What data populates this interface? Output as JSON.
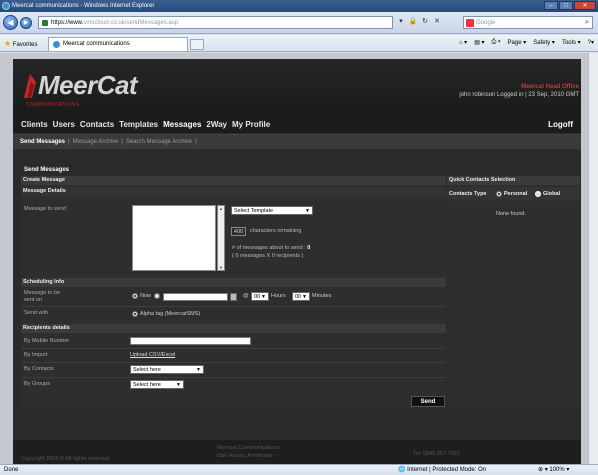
{
  "browser": {
    "title": "Meercat communications - Windows Internet Explorer",
    "address_prefix": "https://www.",
    "address_rest": "smscloud.co.uk/sendMessages.asp",
    "search_placeholder": "Google",
    "favorites_label": "Favorites",
    "tab_title": "Meercat communications",
    "commands": [
      "Page ▾",
      "Safety ▾",
      "Tools ▾"
    ],
    "status_left": "Done",
    "status_zone": "Internet | Protected Mode: On",
    "zoom": "100%"
  },
  "header": {
    "logo_text": "MeerCat",
    "logo_sub": "COMMUNICATIONS",
    "office": "Meercat Head Office",
    "user_line": "john robinson Logged in | 23 Sep, 2010 GMT"
  },
  "mainnav": {
    "items": [
      "Clients",
      "Users",
      "Contacts",
      "Templates",
      "Messages",
      "2Way",
      "My Profile"
    ],
    "logoff": "Logoff"
  },
  "subnav": {
    "items": [
      "Send Messages",
      "Message Archive",
      "Search Message Archive"
    ]
  },
  "form": {
    "page_heading": "Send Messages",
    "create_message": "Create Message",
    "message_details": "Message Details",
    "message_to_send": "Message to send",
    "template_select": "Select Template",
    "chars_remaining_value": "400",
    "chars_remaining_label": "characters remaining",
    "msg_count_label": "# of messages about to send : ",
    "msg_count_value": "0",
    "msg_count_detail": "( 0 messages X 0 recipients )",
    "scheduling_info": "Scheduling Info",
    "message_sent_on": "Message to be sent on",
    "now_label": "Now",
    "at_label": "@",
    "hours_value": "00",
    "hours_label": "Hours",
    "minutes_value": "00",
    "minutes_label": "Minutes",
    "send_with": "Send with",
    "alpha_tag": "Alpha tag (MeercatSMS)",
    "recipients_details": "Recipients details",
    "by_mobile": "By Mobile Number",
    "by_import": "By Import",
    "upload_link": "Upload CSV/Excel",
    "by_contacts": "By Contacts",
    "by_groups": "By Groups",
    "select_here": "Select here",
    "send_button": "Send"
  },
  "quick_contacts": {
    "heading": "Quick Contacts Selection",
    "contacts_type": "Contacts Type",
    "personal": "Personal",
    "global": "Global",
    "none_found": "None found."
  },
  "footer": {
    "copyright": "Copyright 2004 © All rights reserved",
    "company": "Meercat Communications",
    "address": "Oak House, Armthorpe",
    "tel": "Tel: 0845 257 7397"
  },
  "colors": {
    "accent_red": "#c23a3a",
    "site_bg": "#2a2a2a"
  }
}
